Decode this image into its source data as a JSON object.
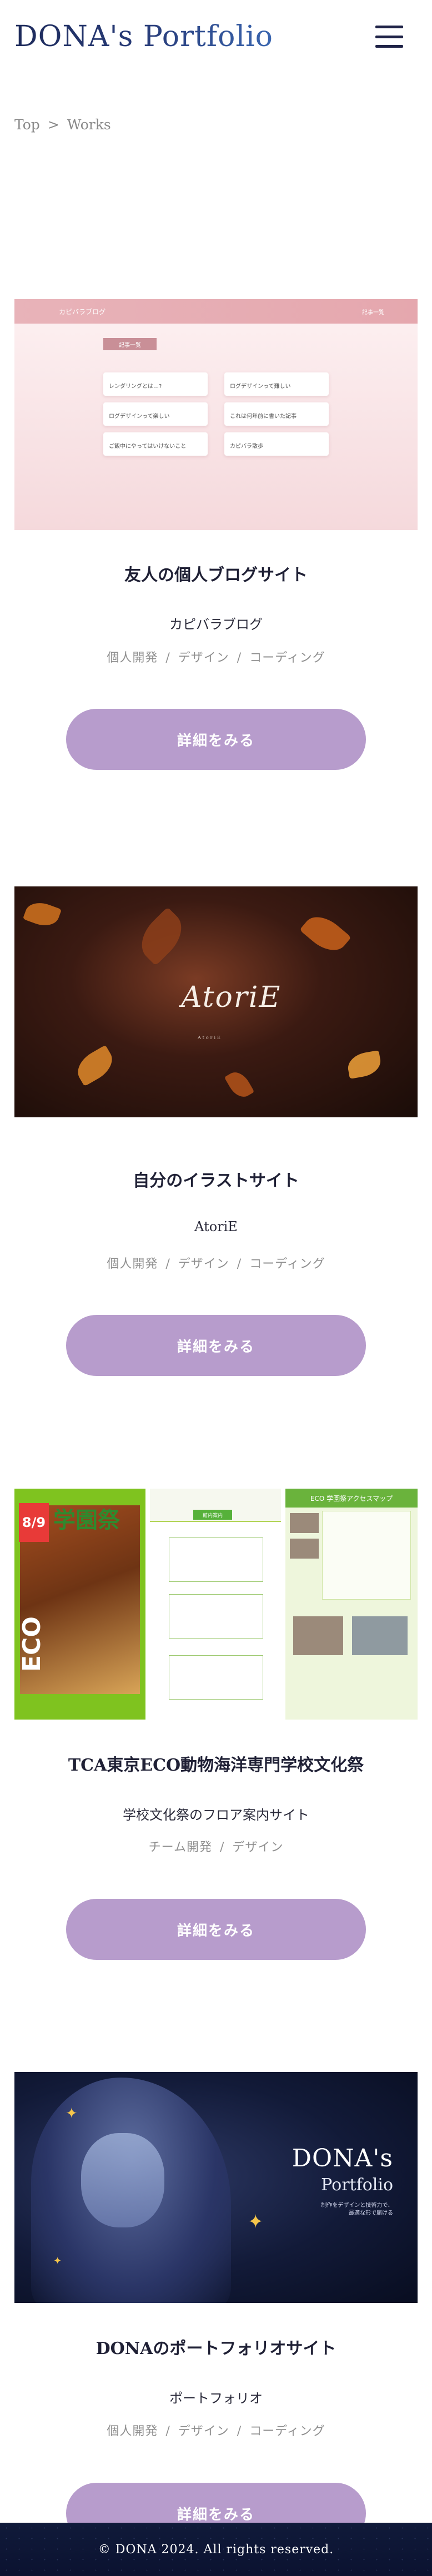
{
  "header": {
    "logo": "DONA's Portfolio",
    "menu_icon": "hamburger-icon"
  },
  "breadcrumb": {
    "home": "Top",
    "separator": ">",
    "current": "Works"
  },
  "works": [
    {
      "title": "友人の個人ブログサイト",
      "subtitle": "カピバラブログ",
      "tags": [
        "個人開発",
        "デザイン",
        "コーディング"
      ],
      "button": "詳細をみる",
      "thumb": {
        "logo": "カピバラブログ",
        "nav": "記事一覧",
        "section": "記事一覧",
        "cards": [
          "レンダリングとは…?",
          "ログデザインって難しい",
          "ログデザインって楽しい",
          "これは何年前に書いた記事",
          "ご飯中にやってはいけないこと",
          "カピバラ散歩"
        ]
      }
    },
    {
      "title": "自分のイラストサイト",
      "subtitle": "AtoriE",
      "tags": [
        "個人開発",
        "デザイン",
        "コーディング"
      ],
      "button": "詳細をみる",
      "thumb": {
        "signature": "AtoriE",
        "small": "AtoriE"
      }
    },
    {
      "title": "TCA東京ECO動物海洋専門学校文化祭",
      "subtitle": "学校文化祭のフロア案内サイト",
      "tags": [
        "チーム開発",
        "デザイン"
      ],
      "button": "詳細をみる",
      "thumb": {
        "date": "8/9",
        "festival": "学園祭",
        "eco": "ECO",
        "tab": "館内案内",
        "map_title": "ECO 学園祭アクセスマップ"
      }
    },
    {
      "title": "DONAのポートフォリオサイト",
      "subtitle": "ポートフォリオ",
      "tags": [
        "個人開発",
        "デザイン",
        "コーディング"
      ],
      "button": "詳細をみる",
      "thumb": {
        "title": "DONA's",
        "subtitle": "Portfolio",
        "note": "制作をデザインと技術力で、\n最適な形で届ける"
      }
    }
  ],
  "footer": {
    "copyright": "© DONA 2024. All rights reserved."
  },
  "colors": {
    "button": "#b79ccc",
    "logo_dark": "#1d2a5a",
    "logo_light": "#3a66b0",
    "footer": "#0b1230"
  }
}
